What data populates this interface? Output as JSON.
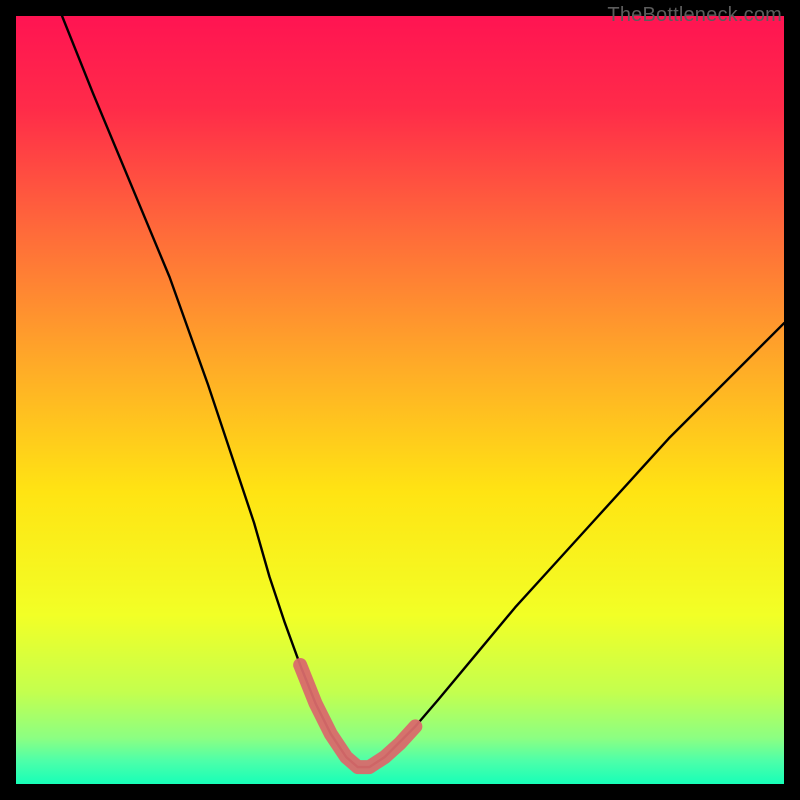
{
  "watermark": "TheBottleneck.com",
  "chart_data": {
    "type": "line",
    "title": "",
    "xlabel": "",
    "ylabel": "",
    "xlim": [
      0,
      100
    ],
    "ylim": [
      0,
      100
    ],
    "series": [
      {
        "name": "bottleneck-curve",
        "x": [
          6,
          10,
          15,
          20,
          25,
          28,
          31,
          33,
          35,
          37,
          39,
          41,
          43,
          44.5,
          46,
          48,
          52,
          55,
          60,
          65,
          70,
          75,
          80,
          85,
          90,
          95,
          100
        ],
        "y": [
          100,
          90,
          78,
          66,
          52,
          43,
          34,
          27,
          21,
          15.5,
          10.5,
          6.5,
          3.5,
          2.2,
          2.2,
          3.5,
          7.5,
          11,
          17,
          23,
          28.5,
          34,
          39.5,
          45,
          50,
          55,
          60
        ]
      }
    ],
    "highlight": {
      "name": "minimum-region",
      "x": [
        37,
        39,
        41,
        43,
        44.5,
        46,
        48,
        50,
        52
      ],
      "y": [
        15.5,
        10.5,
        6.5,
        3.5,
        2.2,
        2.2,
        3.5,
        5.3,
        7.5
      ]
    },
    "gradient_stops": [
      {
        "offset": 0.0,
        "color": "#ff1452"
      },
      {
        "offset": 0.12,
        "color": "#ff2b49"
      },
      {
        "offset": 0.28,
        "color": "#ff6a3a"
      },
      {
        "offset": 0.45,
        "color": "#ffa928"
      },
      {
        "offset": 0.62,
        "color": "#ffe413"
      },
      {
        "offset": 0.78,
        "color": "#f2ff26"
      },
      {
        "offset": 0.88,
        "color": "#c4ff4e"
      },
      {
        "offset": 0.94,
        "color": "#8cff82"
      },
      {
        "offset": 0.97,
        "color": "#4dffa9"
      },
      {
        "offset": 1.0,
        "color": "#17ffb8"
      }
    ]
  }
}
